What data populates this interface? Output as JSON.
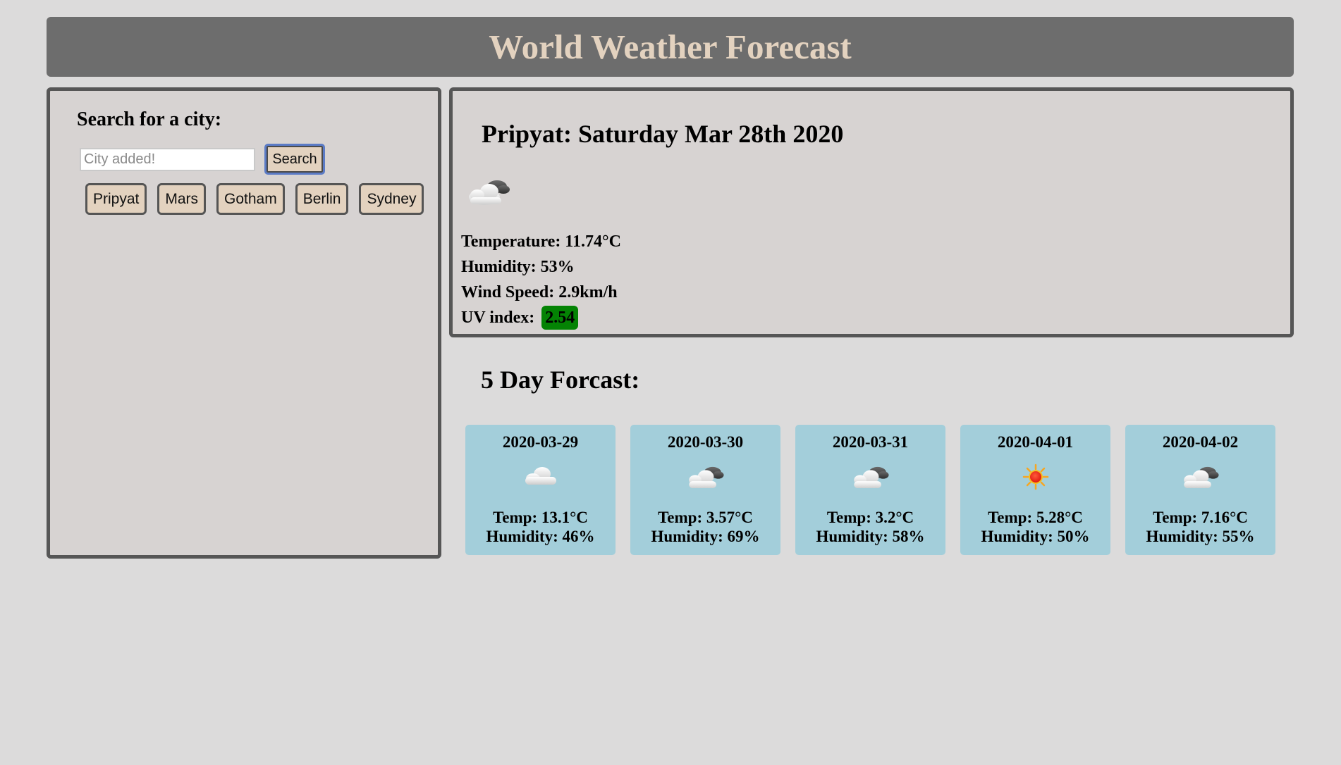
{
  "header": {
    "title": "World Weather Forecast"
  },
  "search": {
    "heading": "Search for a city:",
    "input_value": "",
    "placeholder": "City added!",
    "button_label": "Search",
    "history": [
      "Pripyat",
      "Mars",
      "Gotham",
      "Berlin",
      "Sydney"
    ]
  },
  "current": {
    "title": "Pripyat: Saturday Mar 28th 2020",
    "icon": "cloudy-icon",
    "temperature": "Temperature: 11.74°C",
    "humidity": "Humidity: 53%",
    "wind": "Wind Speed: 2.9km/h",
    "uv_label": "UV index:",
    "uv_value": "2.54",
    "uv_color": "#048304"
  },
  "forecast": {
    "heading": "5 Day Forcast:",
    "days": [
      {
        "date": "2020-03-29",
        "icon": "cloud-icon",
        "temp": "Temp: 13.1°C",
        "humidity": "Humidity: 46%"
      },
      {
        "date": "2020-03-30",
        "icon": "cloudy-icon",
        "temp": "Temp: 3.57°C",
        "humidity": "Humidity: 69%"
      },
      {
        "date": "2020-03-31",
        "icon": "cloudy-icon",
        "temp": "Temp: 3.2°C",
        "humidity": "Humidity: 58%"
      },
      {
        "date": "2020-04-01",
        "icon": "sun-icon",
        "temp": "Temp: 5.28°C",
        "humidity": "Humidity: 50%"
      },
      {
        "date": "2020-04-02",
        "icon": "cloudy-icon",
        "temp": "Temp: 7.16°C",
        "humidity": "Humidity: 55%"
      }
    ]
  },
  "colors": {
    "header_bg": "#6d6d6d",
    "header_text": "#e3d2bf",
    "panel_bg": "#d7d3d2",
    "button_bg": "#e3d2bf",
    "card_bg": "#a3ceda",
    "uv_badge": "#048304"
  }
}
